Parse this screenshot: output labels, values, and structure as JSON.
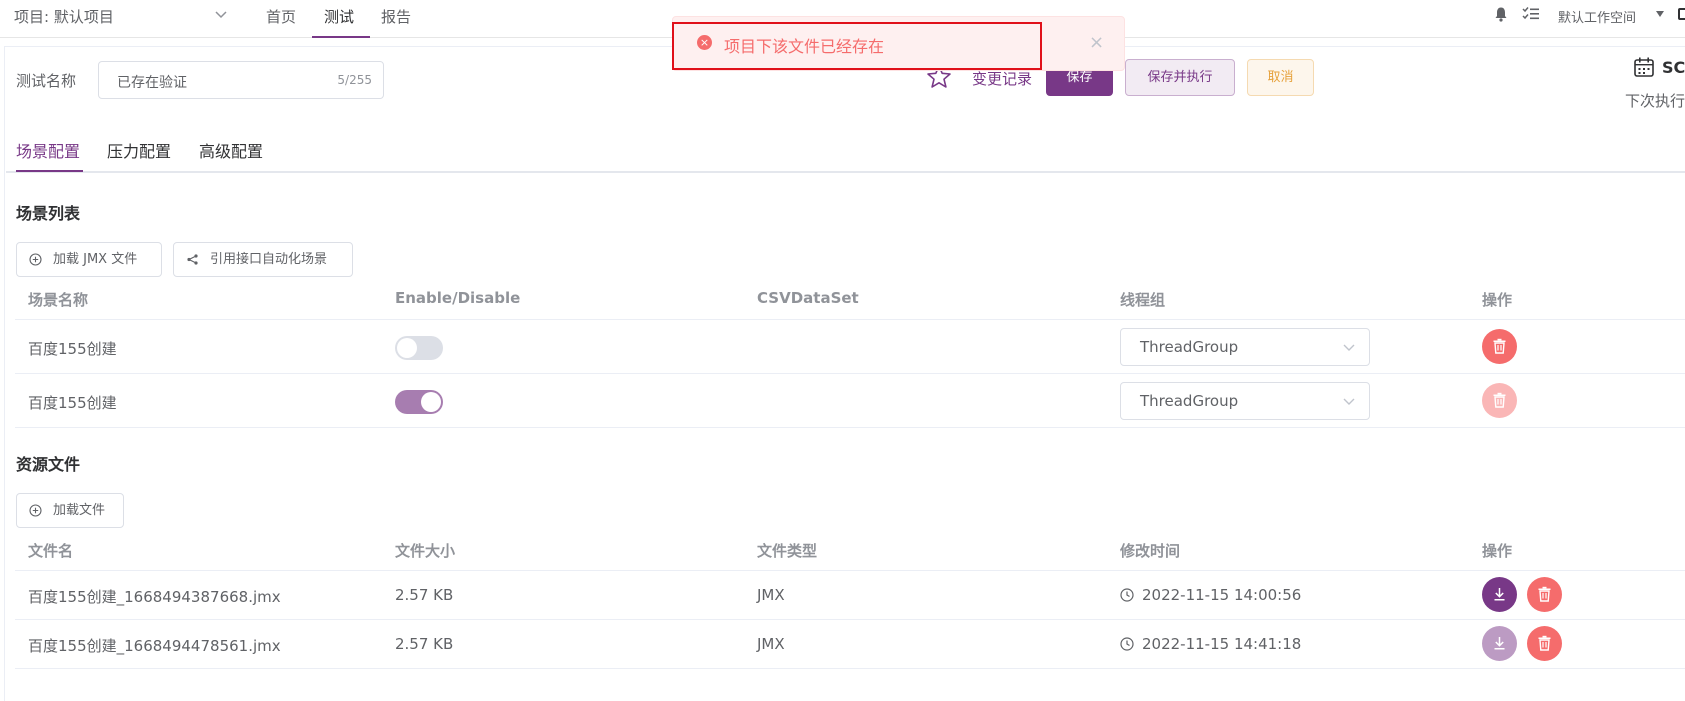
{
  "topbar": {
    "project_label": "项目: 默认项目",
    "nav": [
      "首页",
      "测试",
      "报告"
    ],
    "workspace": "默认工作空间"
  },
  "header": {
    "name_label": "测试名称",
    "name_value": "已存在验证",
    "name_count": "5/255",
    "changelog": "变更记录",
    "save": "保存",
    "save_run": "保存并执行",
    "cancel": "取消",
    "schedule_title": "SC",
    "next_run": "下次执行"
  },
  "toast": {
    "message": "项目下该文件已经存在",
    "close": "×"
  },
  "tabs": [
    "场景配置",
    "压力配置",
    "高级配置"
  ],
  "scenes": {
    "title": "场景列表",
    "load_jmx": "加载 JMX 文件",
    "ref_api": "引用接口自动化场景",
    "columns": [
      "场景名称",
      "Enable/Disable",
      "CSVDataSet",
      "线程组",
      "操作"
    ],
    "rows": [
      {
        "name": "百度155创建",
        "enabled": false,
        "thread_group": "ThreadGroup"
      },
      {
        "name": "百度155创建",
        "enabled": true,
        "thread_group": "ThreadGroup"
      }
    ]
  },
  "resources": {
    "title": "资源文件",
    "load_file": "加载文件",
    "columns": [
      "文件名",
      "文件大小",
      "文件类型",
      "修改时间",
      "操作"
    ],
    "rows": [
      {
        "name": "百度155创建_1668494387668.jmx",
        "size": "2.57 KB",
        "type": "JMX",
        "modified": "2022-11-15 14:00:56"
      },
      {
        "name": "百度155创建_1668494478561.jmx",
        "size": "2.57 KB",
        "type": "JMX",
        "modified": "2022-11-15 14:41:18"
      }
    ]
  },
  "colors": {
    "primary": "#783887",
    "danger": "#f56c6c",
    "warning": "#e6a23c"
  }
}
